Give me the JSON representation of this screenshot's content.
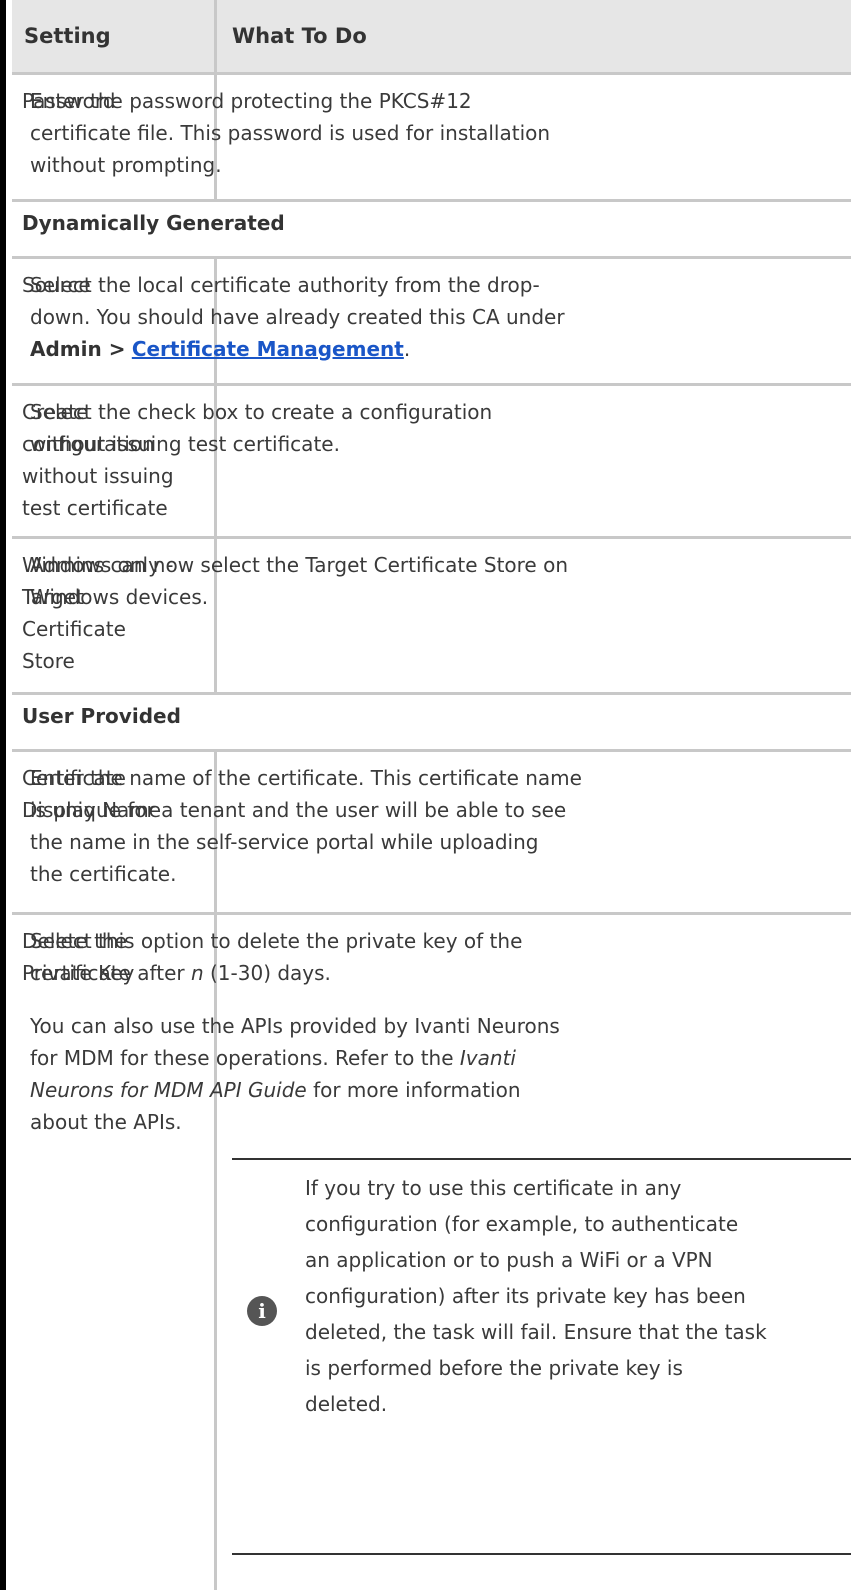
{
  "table": {
    "headers": {
      "setting": "Setting",
      "what_to_do": "What To Do"
    },
    "rows": {
      "password": {
        "setting": "Password",
        "desc_lines": [
          "Enter the password protecting the PKCS#12",
          "certificate file. This password is used for installation",
          "without prompting."
        ]
      },
      "section_dynamic": "Dynamically Generated",
      "source": {
        "setting": "Source",
        "line1": "Select the local certificate authority from the drop-",
        "line2": "down. You should have already created this CA under",
        "admin_label": "Admin >",
        "link_text": "Certificate Management",
        "period": "."
      },
      "create_config": {
        "setting_lines": [
          "Create",
          "configuration",
          "without issuing",
          "test certificate"
        ],
        "desc_lines": [
          "Select the check box to create a configuration",
          "without issuing test certificate."
        ]
      },
      "windows_only": {
        "setting_lines": [
          "Windows only -",
          "Target",
          "Certificate",
          "Store"
        ],
        "desc_lines": [
          "Admins can now select the Target Certificate Store on",
          "Windows devices."
        ]
      },
      "section_user": "User Provided",
      "cert_display_name": {
        "setting_lines": [
          "Certificate",
          "Display Name"
        ],
        "desc_lines": [
          "Enter the name of the certificate. This certificate name",
          "is unique for a tenant and the user will be able to see",
          "the name in the self-service portal while uploading",
          "the certificate."
        ]
      },
      "delete_private_key": {
        "setting_lines": [
          "Delete the",
          "Private Key"
        ],
        "desc1_pre": "Select this option to delete the private key of the",
        "desc1_line2_pre": "certificate after ",
        "desc1_italic": "n",
        "desc1_line2_post": " (1-30) days.",
        "desc2_line1": "You can also use the APIs provided by Ivanti Neurons",
        "desc2_line2_pre": "for MDM for these operations. Refer to the ",
        "desc2_line2_italic": "Ivanti",
        "desc2_line3_italic": "Neurons for MDM API Guide",
        "desc2_line3_post": " for more information",
        "desc2_line4": "about the APIs.",
        "note_icon": "info-icon",
        "note_lines": [
          "If you try to use this certificate in any",
          "configuration (for example, to authenticate",
          "an application or to push a WiFi or a VPN",
          "configuration) after its private key has been",
          "deleted, the task will fail. Ensure that the task",
          "is performed before the private key is",
          "deleted."
        ]
      }
    }
  }
}
